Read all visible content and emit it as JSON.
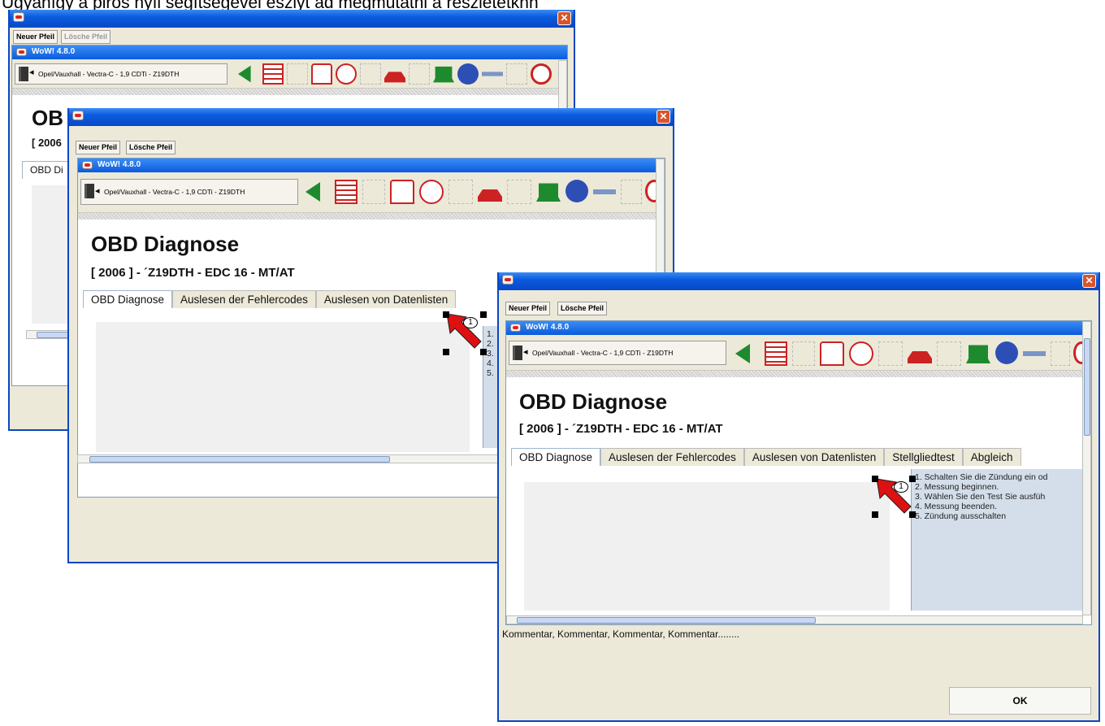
{
  "caption": "Ugyanígy a piros nyíl segítségével eszlyt ad megmutatni a részletetkhh",
  "pfeil": {
    "new_label": "Neuer Pfeil",
    "delete_label": "Lösche Pfeil"
  },
  "app": {
    "title": "WoW! 4.8.0",
    "vehicle": "Opel/Vauxhall - Vectra-C - 1,9 CDTi - Z19DTH"
  },
  "page": {
    "heading": "OBD Diagnose",
    "heading_short": "OB",
    "subheading": "[ 2006 ] - ´Z19DTH - EDC 16 - MT/AT",
    "subheading_short": "[ 2006",
    "tab_short": "OBD Di",
    "tabs": [
      "OBD Diagnose",
      "Auslesen der Fehlercodes",
      "Auslesen von Datenlisten",
      "Stellgliedtest",
      "Abgleich"
    ]
  },
  "steps": [
    "1. Schalten Sie die Zündung ein od",
    "2. Messung beginnen.",
    "3. Wählen Sie den Test Sie ausfüh",
    "4. Messung beenden.",
    "5. Zündung ausschalten"
  ],
  "steps_short": [
    "1.",
    "2.",
    "3.",
    "4.",
    "5."
  ],
  "marker_number": "1",
  "comment": "Kommentar, Kommentar, Kommentar, Kommentar........",
  "ok_label": "OK",
  "close_glyph": "✕",
  "colors": {
    "titlebar": "#0a5bdc",
    "arrow": "#dd1111",
    "panel_steps": "#d3deea"
  }
}
